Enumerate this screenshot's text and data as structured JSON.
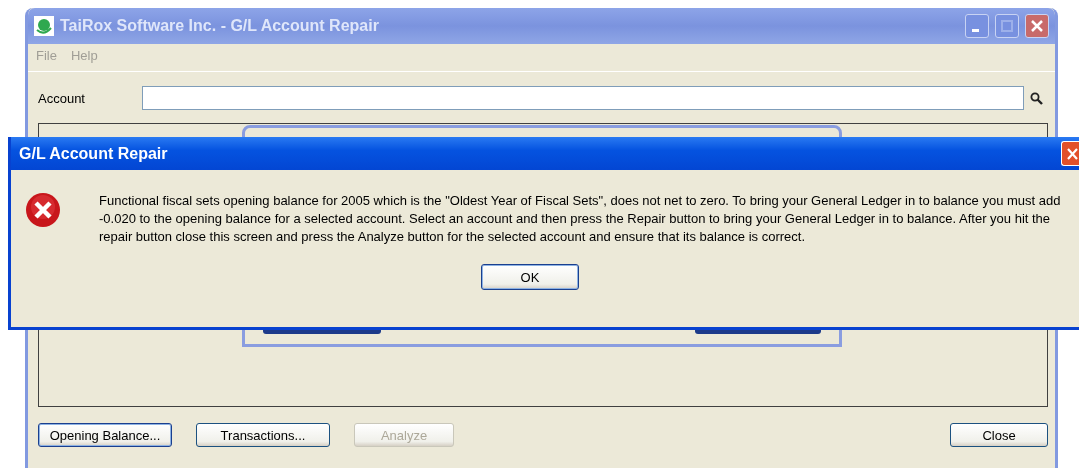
{
  "main_window": {
    "title": "TaiRox Software Inc. - G/L Account Repair",
    "active": false,
    "menu": [
      "File",
      "Help"
    ],
    "account_label": "Account",
    "buttons": [
      {
        "label": "Opening Balance...",
        "focused": true,
        "disabled": false
      },
      {
        "label": "Transactions...",
        "focused": false,
        "disabled": false
      },
      {
        "label": "Analyze",
        "focused": false,
        "disabled": true
      }
    ],
    "close_button": "Close"
  },
  "dialog": {
    "title": "G/L Account Repair",
    "message": "Functional fiscal sets opening balance for 2005 which is the \"Oldest Year of Fiscal Sets\", does not net to zero. To bring your General Ledger in to balance you must add -0.020 to the opening balance for a selected account. Select an account and then press the Repair button to bring your General Ledger in to balance. After you hit the repair button close this screen and press the Analyze button for the selected account and ensure that its balance is correct.",
    "buttons": [
      "OK"
    ]
  }
}
